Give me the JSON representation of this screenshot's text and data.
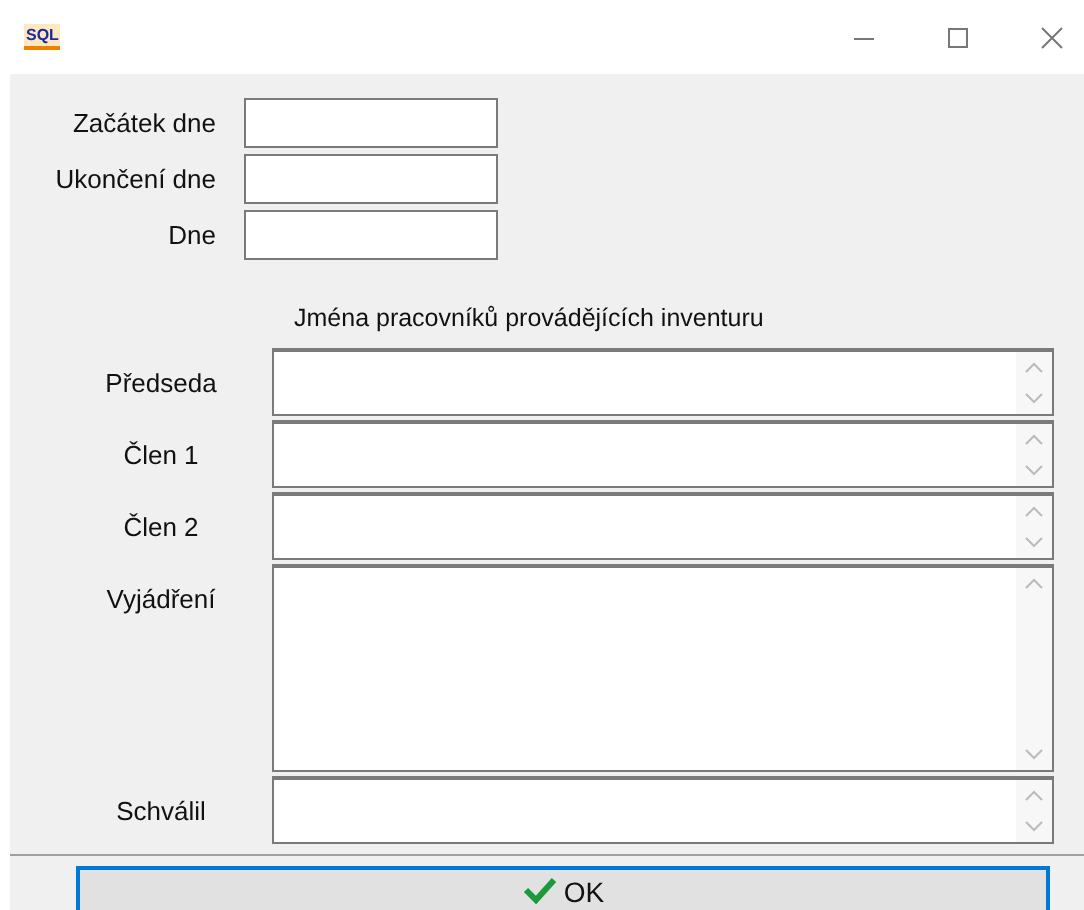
{
  "window": {
    "app_icon_text": "SQL"
  },
  "date_fields": [
    {
      "label": "Začátek dne"
    },
    {
      "label": "Ukončení dne"
    },
    {
      "label": "Dne"
    }
  ],
  "section_heading": "Jména pracovníků provádějících inventuru",
  "memo_fields": [
    {
      "label": "Předseda",
      "kind": "single"
    },
    {
      "label": "Člen 1",
      "kind": "single"
    },
    {
      "label": "Člen 2",
      "kind": "single"
    },
    {
      "label": "Vyjádření",
      "kind": "tall"
    },
    {
      "label": "Schválil",
      "kind": "single"
    }
  ],
  "buttons": [
    {
      "label": "OK"
    }
  ]
}
